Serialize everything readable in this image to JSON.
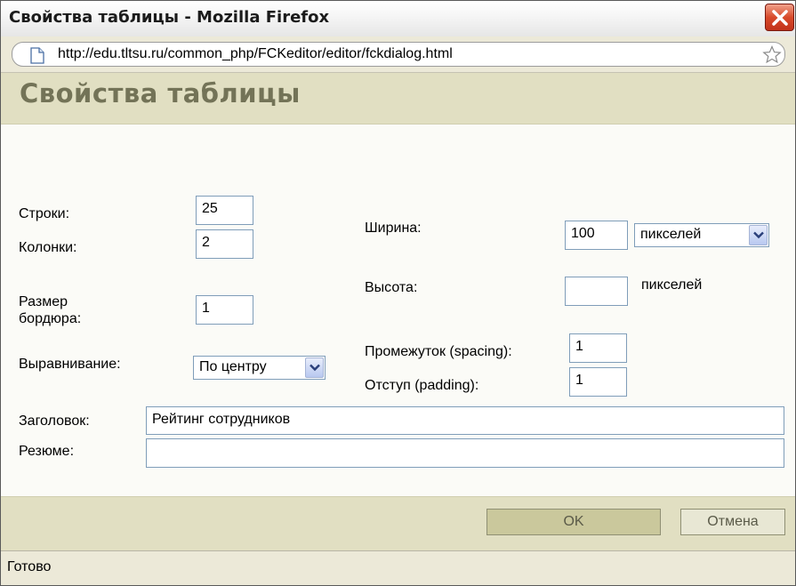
{
  "window": {
    "title": "Свойства таблицы - Mozilla Firefox",
    "url": "http://edu.tltsu.ru/common_php/FCKeditor/editor/fckdialog.html",
    "status": "Готово"
  },
  "dialog": {
    "title": "Свойства таблицы",
    "rows_label": "Строки:",
    "rows_value": "25",
    "cols_label": "Колонки:",
    "cols_value": "2",
    "border_label_1": "Размер",
    "border_label_2": "бордюра:",
    "border_value": "1",
    "align_label": "Выравнивание:",
    "align_value": "По центру",
    "width_label": "Ширина:",
    "width_value": "100",
    "width_unit": "пикселей",
    "height_label": "Высота:",
    "height_value": "",
    "height_unit": "пикселей",
    "spacing_label": "Промежуток (spacing):",
    "spacing_value": "1",
    "padding_label": "Отступ (padding):",
    "padding_value": "1",
    "caption_label": "Заголовок:",
    "caption_value": "Рейтинг сотрудников",
    "summary_label": "Резюме:",
    "summary_value": "",
    "ok_label": "OK",
    "cancel_label": "Отмена"
  },
  "icons": {
    "close": "close-icon",
    "page": "page-icon",
    "star": "star-icon",
    "dropdown": "chevron-down-icon"
  },
  "colors": {
    "header_bg": "#e1dfc2",
    "title_color": "#737357",
    "ok_button": "#cac89c",
    "close_button": "#d84a2a"
  }
}
